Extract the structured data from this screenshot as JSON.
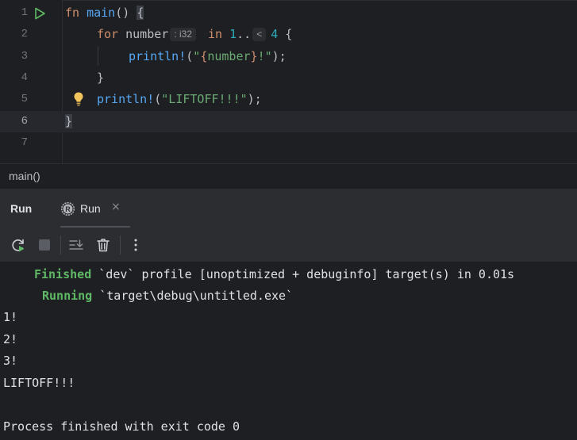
{
  "editor": {
    "lines": [
      {
        "num": "1"
      },
      {
        "num": "2"
      },
      {
        "num": "3"
      },
      {
        "num": "4"
      },
      {
        "num": "5"
      },
      {
        "num": "6"
      },
      {
        "num": "7"
      }
    ],
    "code": {
      "l1_kw": "fn",
      "l1_name": "main",
      "l1_rest": "() ",
      "l1_brace": "{",
      "l2_for": "for",
      "l2_var": "number",
      "l2_type_hint": ": i32",
      "l2_in": "in",
      "l2_start": "1",
      "l2_range": "..",
      "l2_range_hint": "<",
      "l2_end": "4",
      "l2_open": " {",
      "l3_macro": "println!",
      "l3_open": "(",
      "l3_q1": "\"",
      "l3_interp_open": "{",
      "l3_var": "number",
      "l3_interp_close": "}",
      "l3_tail": "!\"",
      "l3_close": ");",
      "l4": "}",
      "l5_macro": "println!",
      "l5_open": "(",
      "l5_str": "\"LIFTOFF!!!\"",
      "l5_close": ");",
      "l6_brace": "}"
    }
  },
  "breadcrumb": {
    "label": "main()"
  },
  "run_panel": {
    "title": "Run",
    "tab_label": "Run",
    "tab_close": "×"
  },
  "console": {
    "finished_label": "Finished",
    "finished_text": " `dev` profile [unoptimized + debuginfo] target(s) in 0.01s",
    "running_label": "Running",
    "running_text": " `target\\debug\\untitled.exe`",
    "output": [
      "1!",
      "2!",
      "3!",
      "LIFTOFF!!!"
    ],
    "exit_message": "Process finished with exit code 0"
  },
  "icons": {
    "run_gutter": "run-triangle-icon",
    "bulb": "lightbulb-icon",
    "rerun": "rerun-icon",
    "stop": "stop-icon",
    "scroll_end": "scroll-to-end-icon",
    "trash": "trash-icon",
    "more": "more-vertical-icon",
    "rust_tab": "rust-icon"
  },
  "colors": {
    "background": "#1e1f22",
    "panel": "#2b2d30",
    "keyword": "#cf8e6d",
    "function": "#56a8f5",
    "string": "#6aab73",
    "number": "#2aacb8",
    "success_green": "#5fb865"
  }
}
